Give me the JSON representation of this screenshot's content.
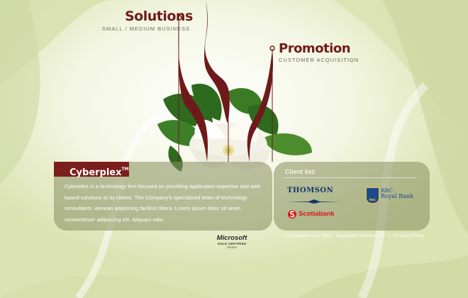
{
  "nav": [
    {
      "title": "Solutions",
      "subtitle": "SMALL / MEDIUM BUSINESS"
    },
    {
      "title": "Promotion",
      "subtitle": "CUSTOMER ACQUISITION"
    }
  ],
  "brand": {
    "name": "Cyberplex",
    "tm": "TM"
  },
  "intro_text": "Cyberplex is a technology firm focused on providing application expertise and web based solutions to its clients. The Company's specialized team of technology consultants. Aenean adipiscing facilisis libero. Lorem ipsum dolor sit amet, consectetuer adipiscing elit. Aliquam odio.",
  "clients": {
    "title": "Client list:",
    "thomson": "THOMSON",
    "rbc_badge": "RBC",
    "rbc_line1": "RBC",
    "rbc_line2": "Royal Bank",
    "scotiabank": "Scotiabank"
  },
  "partner": {
    "brand": "Microsoft",
    "level": "GOLD CERTIFIED",
    "role": "Partner"
  },
  "footer": {
    "copyright": "© Cyberplex Inc. 2007",
    "copyright_link": "Copyright Information",
    "separator": "|",
    "privacy_link": "Privacy Policy"
  },
  "colors": {
    "accent": "#7a1e1e",
    "background": "#e6ecc6",
    "panel": "#868e5c"
  }
}
